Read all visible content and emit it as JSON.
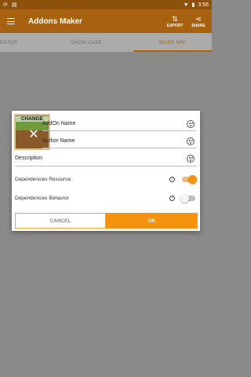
{
  "statusbar": {
    "time": "3:56",
    "left_icons": [
      "sync-icon",
      "card-icon"
    ],
    "right_icons": [
      "wifi-icon",
      "battery-icon"
    ]
  },
  "appbar": {
    "title": "Addons Maker",
    "actions": [
      {
        "label": "EXPORT",
        "icon": "export-icon"
      },
      {
        "label": "SHARE",
        "icon": "share-icon"
      }
    ]
  },
  "tabs": [
    {
      "label": "EATOR"
    },
    {
      "label": "SHOW CASE"
    },
    {
      "label": "MORE APP",
      "selected": true
    }
  ],
  "dialog": {
    "thumbnail_caption": "CHANGE",
    "addon_name": "AddOn Name",
    "author_name": "Author Name",
    "description": "Description",
    "toggles": [
      {
        "label": "Dependencies Resource",
        "on": true
      },
      {
        "label": "Dependencies Behavior",
        "on": false
      }
    ],
    "help_glyph": "?",
    "cancel_label": "CANCEL",
    "ok_label": "OK"
  },
  "colors": {
    "accent": "#f5920f",
    "appbar": "#a8620f",
    "statusbar": "#8c520d"
  }
}
